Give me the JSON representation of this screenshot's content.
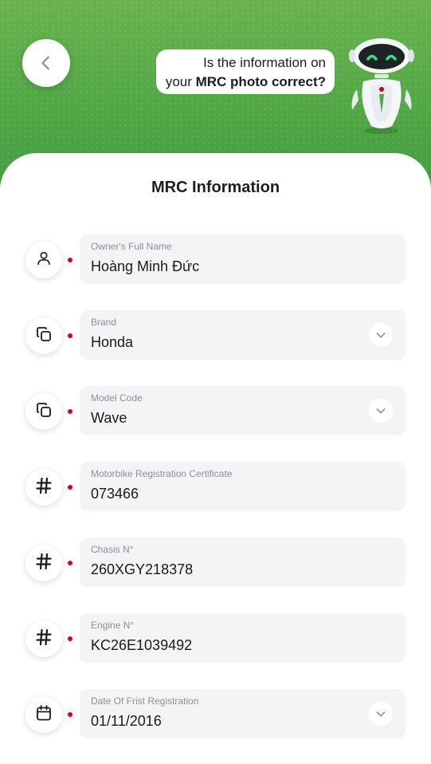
{
  "header": {
    "bubble_line1": "Is the information on",
    "bubble_prefix": "your ",
    "bubble_bold": "MRC photo correct?"
  },
  "title": "MRC Information",
  "fields": [
    {
      "label": "Owner's Full Name",
      "value": "Hoàng Minh Đức",
      "icon": "user-icon",
      "dropdown": false
    },
    {
      "label": "Brand",
      "value": "Honda",
      "icon": "copy-icon",
      "dropdown": true
    },
    {
      "label": "Model Code",
      "value": "Wave",
      "icon": "copy-icon",
      "dropdown": true
    },
    {
      "label": "Motorbike Registration Certificate",
      "value": "073466",
      "icon": "hash-icon",
      "dropdown": false
    },
    {
      "label": "Chasis N°",
      "value": "260XGY218378",
      "icon": "hash-icon",
      "dropdown": false
    },
    {
      "label": "Engine N°",
      "value": "KC26E1039492",
      "icon": "hash-icon",
      "dropdown": false
    },
    {
      "label": "Date Of Frist Registration",
      "value": "01/11/2016",
      "icon": "calendar-icon",
      "dropdown": true
    }
  ],
  "colors": {
    "header_green": "#4ea544",
    "required_dot": "#d0021b",
    "field_bg": "#f3f4f6"
  }
}
